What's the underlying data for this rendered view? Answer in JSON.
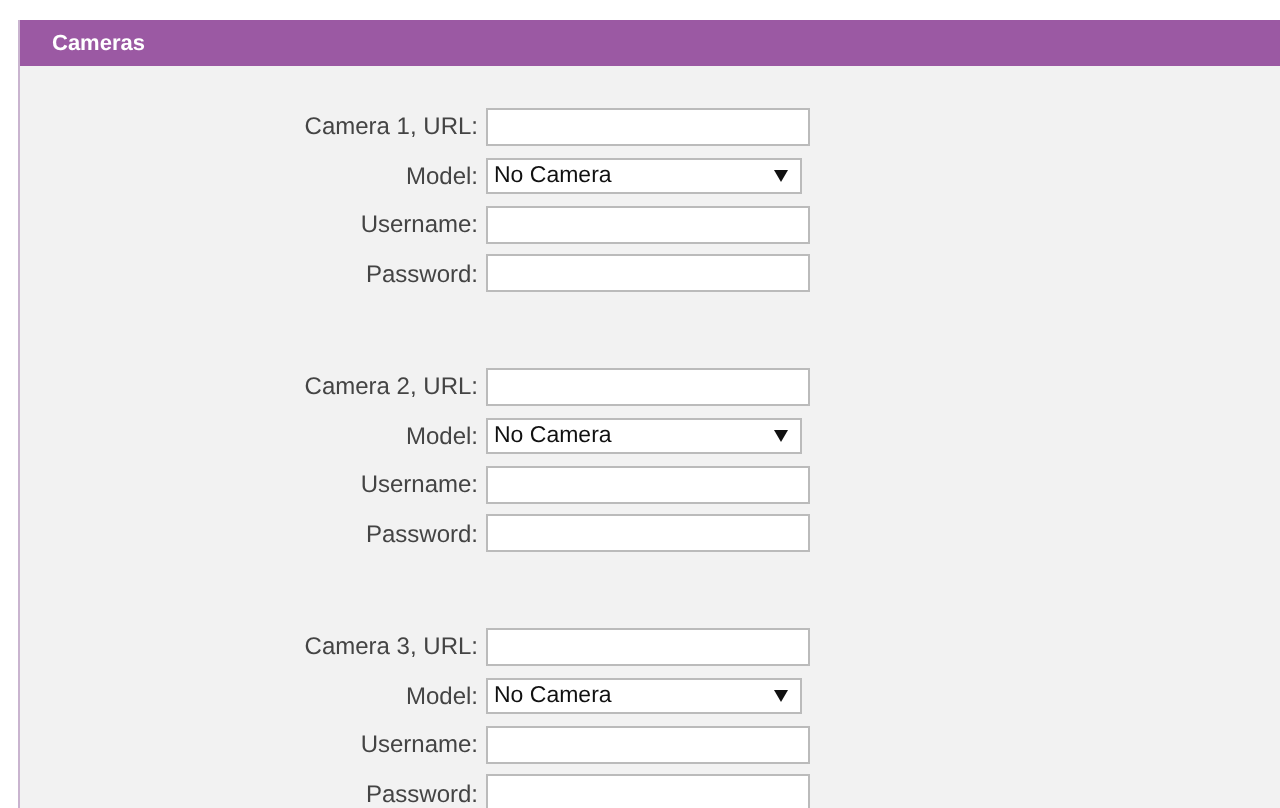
{
  "panel": {
    "title": "Cameras"
  },
  "cameras": [
    {
      "fields": [
        {
          "kind": "text",
          "label": "Camera 1, URL:"
        },
        {
          "kind": "select",
          "label": "Model:",
          "value": "No Camera"
        },
        {
          "kind": "text",
          "label": "Username:"
        },
        {
          "kind": "password",
          "label": "Password:"
        }
      ]
    },
    {
      "fields": [
        {
          "kind": "text",
          "label": "Camera 2, URL:"
        },
        {
          "kind": "select",
          "label": "Model:",
          "value": "No Camera"
        },
        {
          "kind": "text",
          "label": "Username:"
        },
        {
          "kind": "password",
          "label": "Password:"
        }
      ]
    },
    {
      "fields": [
        {
          "kind": "text",
          "label": "Camera 3, URL:"
        },
        {
          "kind": "select",
          "label": "Model:",
          "value": "No Camera"
        },
        {
          "kind": "text",
          "label": "Username:"
        },
        {
          "kind": "password",
          "label": "Password:"
        }
      ]
    }
  ]
}
